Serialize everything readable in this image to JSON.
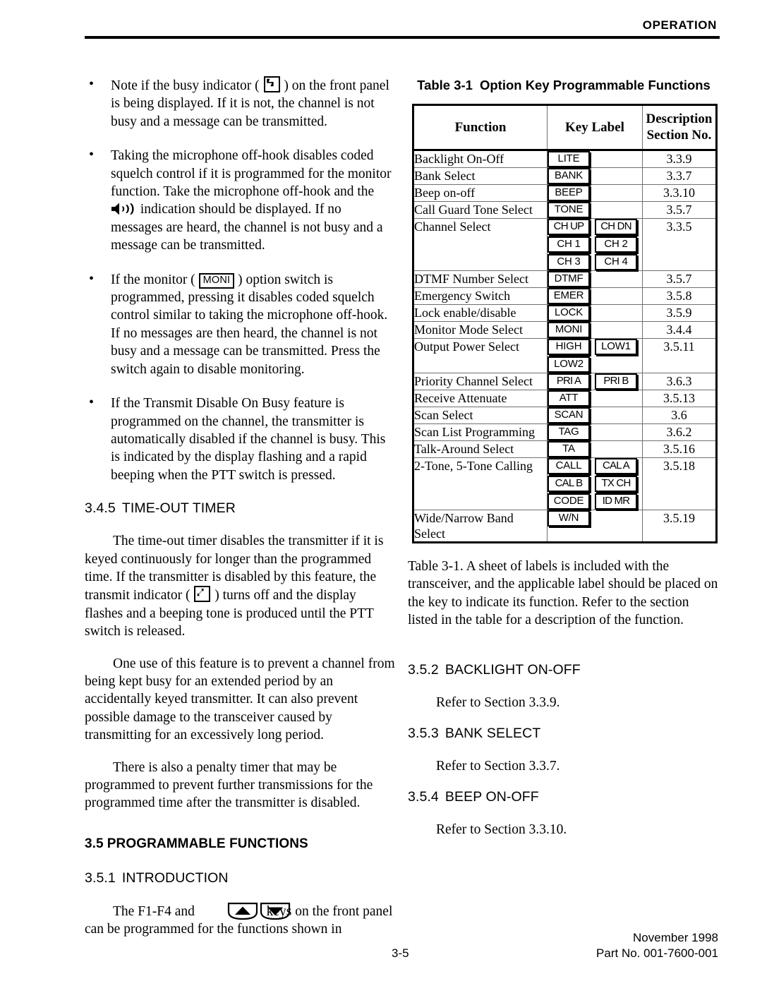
{
  "header": {
    "title": "OPERATION"
  },
  "footer": {
    "page_number": "3-5",
    "date": "November 1998",
    "part_no": "Part No. 001-7600-001"
  },
  "left_column": {
    "bullets": [
      {
        "id": "busy-indicator",
        "text_before": "Note if the busy indicator ( ",
        "icon": "busy-indicator-icon",
        "text_after": " ) on the front panel is being displayed. If it is not, the channel is not busy and a message can be transmitted."
      },
      {
        "id": "microphone-offhook",
        "text_before": "Taking the microphone off-hook disables coded squelch control if it is programmed for the monitor function. Take the microphone off-hook and the ",
        "icon": "speaker-icon",
        "text_after": " indication should be displayed. If no messages are heard, the channel is not busy and a message can be transmitted."
      },
      {
        "id": "monitor-switch",
        "text_before": "If the monitor ( ",
        "icon": "moni-key",
        "icon_label": "MONI",
        "text_after": " ) option switch is programmed, pressing it disables coded squelch control similar to taking the microphone off-hook. If no messages are then heard, the channel is not busy and a message can be transmitted. Press the switch again to disable monitoring."
      },
      {
        "id": "transmit-disable-on-busy",
        "text_before": "If the Transmit Disable On Busy feature is programmed on the channel, the transmitter is automatically disabled if the channel is busy. This is indicated by the display flashing and a rapid beeping when the PTT switch is pressed.",
        "icon": "",
        "text_after": ""
      }
    ],
    "section_345": {
      "number": "3.4.5",
      "title": "TIME-OUT TIMER",
      "para1_before": "The time-out timer disables the transmitter if it is keyed continuously for longer than the programmed time. If the transmitter is disabled by this feature, the transmit indicator ( ",
      "para1_icon": "transmit-indicator-icon",
      "para1_after": " ) turns off and the display flashes and a beeping tone is produced until the PTT switch is released.",
      "para2": "One use of this feature is to prevent a channel from being kept busy for an extended period by an accidentally keyed transmitter. It can also prevent possible damage to the transceiver caused by transmitting for an excessively long period.",
      "para3": "There is also a penalty timer that may be programmed to prevent further transmissions for the programmed time after the transmitter is disabled."
    },
    "section_35": {
      "number": "3.5",
      "title": "PROGRAMMABLE FUNCTIONS"
    },
    "section_351": {
      "number": "3.5.1",
      "title": "INTRODUCTION",
      "para_before": "The F1-F4 and ",
      "icon_up": "arrow-up-key-icon",
      "icon_down": "arrow-down-key-icon",
      "para_after": " keys on the front panel can be programmed for the functions shown in"
    }
  },
  "right_column": {
    "table_caption": {
      "number": "Table 3-1",
      "title": "Option Key Programmable Functions"
    },
    "table": {
      "headers": {
        "function": "Function",
        "key_label": "Key Label",
        "description_line1": "Description",
        "description_line2": "Section No."
      },
      "rows": [
        {
          "function": "Backlight On-Off",
          "keys": [
            [
              "LITE"
            ]
          ],
          "section": "3.3.9"
        },
        {
          "function": "Bank Select",
          "keys": [
            [
              "BANK"
            ]
          ],
          "section": "3.3.7"
        },
        {
          "function": "Beep on-off",
          "keys": [
            [
              "BEEP"
            ]
          ],
          "section": "3.3.10"
        },
        {
          "function": "Call Guard Tone Select",
          "keys": [
            [
              "TONE"
            ]
          ],
          "section": "3.5.7"
        },
        {
          "function": "Channel Select",
          "keys": [
            [
              "CH UP",
              "CH DN"
            ],
            [
              "CH 1",
              "CH 2"
            ],
            [
              "CH 3",
              "CH 4"
            ]
          ],
          "section": "3.3.5"
        },
        {
          "function": "DTMF Number Select",
          "keys": [
            [
              "DTMF"
            ]
          ],
          "section": "3.5.7"
        },
        {
          "function": "Emergency Switch",
          "keys": [
            [
              "EMER"
            ]
          ],
          "section": "3.5.8"
        },
        {
          "function": "Lock enable/disable",
          "keys": [
            [
              "LOCK"
            ]
          ],
          "section": "3.5.9"
        },
        {
          "function": "Monitor Mode Select",
          "keys": [
            [
              "MONI"
            ]
          ],
          "section": "3.4.4"
        },
        {
          "function": "Output Power Select",
          "keys": [
            [
              "HIGH",
              "LOW1"
            ],
            [
              "LOW2"
            ]
          ],
          "section": "3.5.11"
        },
        {
          "function": "Priority Channel Select",
          "keys": [
            [
              "PRI A",
              "PRI B"
            ]
          ],
          "section": "3.6.3"
        },
        {
          "function": "Receive Attenuate",
          "keys": [
            [
              "ATT"
            ]
          ],
          "section": "3.5.13"
        },
        {
          "function": "Scan Select",
          "keys": [
            [
              "SCAN"
            ]
          ],
          "section": "3.6"
        },
        {
          "function": "Scan List Programming",
          "keys": [
            [
              "TAG"
            ]
          ],
          "section": "3.6.2"
        },
        {
          "function": "Talk-Around Select",
          "keys": [
            [
              "TA"
            ]
          ],
          "section": "3.5.16"
        },
        {
          "function": "2-Tone, 5-Tone Calling",
          "keys": [
            [
              "CALL",
              "CAL A"
            ],
            [
              "CAL B",
              "TX CH"
            ],
            [
              "CODE",
              "ID MR"
            ]
          ],
          "section": "3.5.18"
        },
        {
          "function": "Wide/Narrow Band Select",
          "keys": [
            [
              "W/N"
            ]
          ],
          "section": "3.5.19"
        }
      ]
    },
    "after_table_para": "Table 3-1. A sheet of labels is included with the transceiver, and the applicable label should be placed on the key to indicate its function. Refer to the section listed in the table for a description of the function.",
    "section_352": {
      "number": "3.5.2",
      "title": "BACKLIGHT ON-OFF",
      "body": "Refer to Section 3.3.9."
    },
    "section_353": {
      "number": "3.5.3",
      "title": "BANK SELECT",
      "body": "Refer to Section 3.3.7."
    },
    "section_354": {
      "number": "3.5.4",
      "title": "BEEP ON-OFF",
      "body": "Refer to Section 3.3.10."
    }
  },
  "colors": {
    "text": "#000000",
    "background": "#ffffff",
    "table_grid": "#6f6f6f",
    "table_outer": "#000000"
  }
}
